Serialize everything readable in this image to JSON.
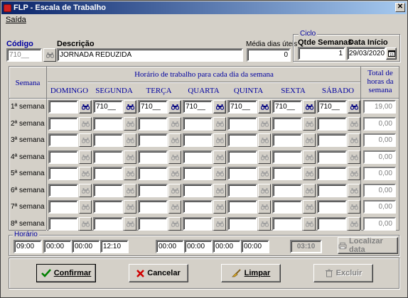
{
  "window": {
    "title": "FLP - Escala de Trabalho",
    "close_glyph": "✕"
  },
  "menu": {
    "saida": "Saída"
  },
  "header": {
    "codigo_label": "Código",
    "codigo_value": "710__",
    "descricao_label": "Descrição",
    "descricao_value": "JORNADA REDUZIDA",
    "media_label": "Média dias úteis",
    "media_value": "0",
    "ciclo_label": "Ciclo",
    "qtde_label": "Qtde Semanas",
    "qtde_value": "1",
    "data_label": "Data Início",
    "data_value": "29/03/2020"
  },
  "grid": {
    "semana_header": "Semana",
    "horario_header": "Horário de trabalho para cada dia da semana",
    "total_header_1": "Total de",
    "total_header_2": "horas da",
    "total_header_3": "semana",
    "days": [
      "DOMINGO",
      "SEGUNDA",
      "TERÇA",
      "QUARTA",
      "QUINTA",
      "SEXTA",
      "SÁBADO"
    ],
    "rows": [
      {
        "label": "1ª semana",
        "cells": [
          "",
          "710__",
          "710__",
          "710__",
          "710__",
          "710__",
          "710__"
        ],
        "total": "19,00"
      },
      {
        "label": "2ª semana",
        "cells": [
          "",
          "",
          "",
          "",
          "",
          "",
          ""
        ],
        "total": "0,00"
      },
      {
        "label": "3ª semana",
        "cells": [
          "",
          "",
          "",
          "",
          "",
          "",
          ""
        ],
        "total": "0,00"
      },
      {
        "label": "4ª semana",
        "cells": [
          "",
          "",
          "",
          "",
          "",
          "",
          ""
        ],
        "total": "0,00"
      },
      {
        "label": "5ª semana",
        "cells": [
          "",
          "",
          "",
          "",
          "",
          "",
          ""
        ],
        "total": "0,00"
      },
      {
        "label": "6ª semana",
        "cells": [
          "",
          "",
          "",
          "",
          "",
          "",
          ""
        ],
        "total": "0,00"
      },
      {
        "label": "7ª semana",
        "cells": [
          "",
          "",
          "",
          "",
          "",
          "",
          ""
        ],
        "total": "0,00"
      },
      {
        "label": "8ª semana",
        "cells": [
          "",
          "",
          "",
          "",
          "",
          "",
          ""
        ],
        "total": "0,00"
      }
    ]
  },
  "horario": {
    "label": "Horário",
    "values": [
      "09:00",
      "00:00",
      "00:00",
      "12:10",
      "00:00",
      "00:00",
      "00:00",
      "00:00"
    ],
    "total": "03:10",
    "localizar_label": "Localizar data"
  },
  "actions": {
    "confirmar": "Confirmar",
    "cancelar": "Cancelar",
    "limpar": "Limpar",
    "excluir": "Excluir"
  }
}
